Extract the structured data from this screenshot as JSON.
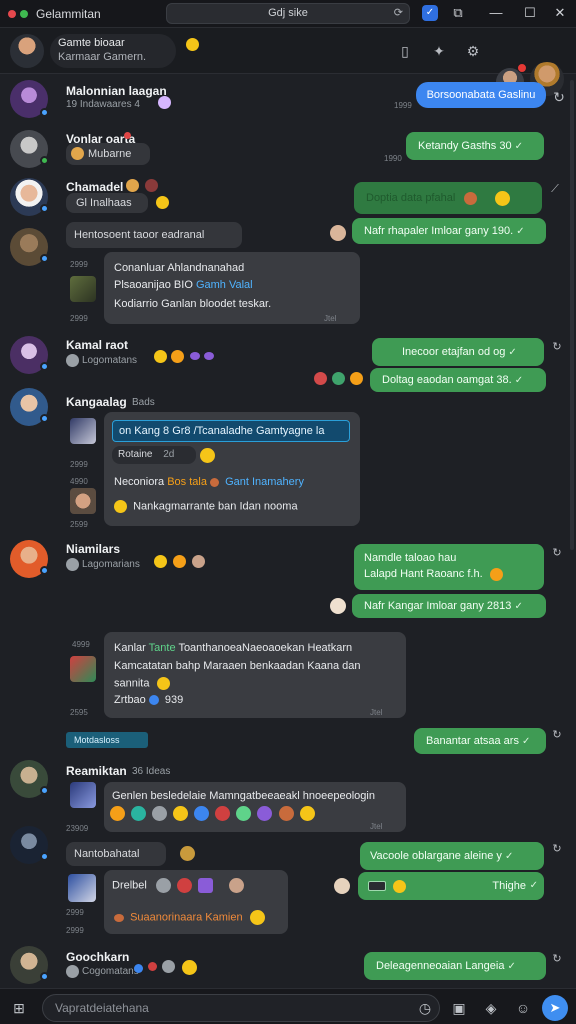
{
  "window": {
    "title": "Gelammitan",
    "address": "Gdj sike"
  },
  "header": {
    "name": "Gamte bioaar",
    "subtitle": "Karmaar Gamern."
  },
  "colors": {
    "outgoing": "#3f9b54",
    "incoming": "#3a3c41",
    "accent": "#3c86f0",
    "link": "#2a9fd8"
  },
  "chats": [
    {
      "name": "Malonnian laagan",
      "sub": "19 Indawaares 4",
      "time": "1999"
    },
    {
      "name": "Vonlar oarta",
      "sub": "Mubarne"
    },
    {
      "name": "Chamadel",
      "sub": "Gl Inalhaas"
    },
    {
      "name": "Kamal raot",
      "sub": "Logomatans"
    },
    {
      "name": "Kangaalag",
      "sub": "Bads"
    },
    {
      "name": "Niamilars",
      "sub": "Lagomarians"
    },
    {
      "name": "Reamiktan",
      "sub": "36 Ideas"
    },
    {
      "name": "Goochkarn",
      "sub": "Cogomatans"
    }
  ],
  "messages": {
    "out_blue": "Borsoonabata Gaslinu",
    "out_1": "Ketandy Gasths 30",
    "out_1_time": "1990",
    "out_2": "Doptia data pfahal",
    "out_3": "Nafr rhapaler Imloar gany 190.",
    "in_chip_1": "Hentosoent taoor eadranal",
    "in_card_1_l1": "Conanluar Ahlandnanahad",
    "in_card_1_l2a": "Plsaoanijao BIO",
    "in_card_1_l2b": "Gamh Valal",
    "in_card_1_l3": "Kodiarrio Ganlan bloodet teskar.",
    "in_card_1_t1": "2999",
    "in_card_1_t2": "2999",
    "in_card_1_t3": "Jtel",
    "out_4": "Inecoor etajfan od og",
    "out_5": "Doltag eaodan oamgat 38.",
    "in_card_2_link": "on Kang 8 Gr8 /Tcanaladhe Gamtyagne la",
    "in_card_2_chip": "Rotaine",
    "in_card_2_chip_num": "2d",
    "in_card_2_l2a": "Neconiora",
    "in_card_2_l2b": "Bos tala",
    "in_card_2_l2c": "Gant Inamahery",
    "in_card_2_l3": "Nankagmarrante ban Idan nooma",
    "in_card_2_t1": "2999",
    "in_card_2_t2": "4990",
    "in_card_2_t3": "2599",
    "out_6_l1": "Namdle taloao hau",
    "out_6_l2": "Lalapd Hant Raoanc f.h.",
    "out_7": "Nafr Kangar Imloar gany 2813",
    "in_card_3_l1a": "Kanlar",
    "in_card_3_l1b": "Tante",
    "in_card_3_l1c": "ToanthanoeaNaeoaoekan Heatkarn",
    "in_card_3_l2": "Kamcatatan bahp Maraaen benkaadan Kaana dan",
    "in_card_3_l3": "sannita",
    "in_card_3_l4": "Zrtbao",
    "in_card_3_l4b": "939",
    "in_card_3_t1": "4999",
    "in_card_3_t2": "2595",
    "in_card_3_t3": "Jtel",
    "tag_teal": "Motdasloss",
    "out_8": "Banantar atsaa ars",
    "in_card_4": "Genlen besledelaie Mamngatbeeaeakl hnoeepeologin",
    "in_card_4_t1": "23909",
    "in_card_4_t2": "Jtel",
    "in_chip_2": "Nantobahatal",
    "out_9": "Vacoole oblargane aleine y",
    "out_10": "Thighe",
    "in_card_5_name": "Drelbel",
    "in_card_5_l2": "Suaanorinaara Kamien",
    "in_card_5_t1": "2999",
    "in_card_5_t2": "2999",
    "out_11": "Deleagenneoaian Langeia"
  },
  "composer": {
    "placeholder": "Vapratdeiatehana"
  }
}
